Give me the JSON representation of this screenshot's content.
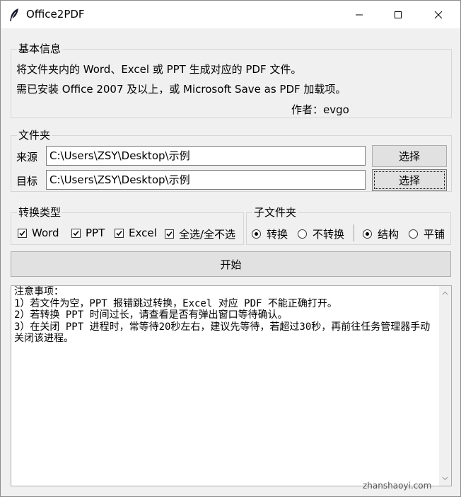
{
  "window": {
    "title": "Office2PDF",
    "icon": "feather-icon",
    "controls": [
      "minimize-icon",
      "maximize-icon",
      "close-icon"
    ]
  },
  "basic_info": {
    "legend": "基本信息",
    "line1": "将文件夹内的 Word、Excel 或 PPT 生成对应的 PDF 文件。",
    "line2": "需已安装 Office 2007 及以上，或 Microsoft Save as PDF 加载项。",
    "author": "作者：evgo"
  },
  "folder": {
    "legend": "文件夹",
    "source_label": "来源",
    "source_value": "C:\\Users\\ZSY\\Desktop\\示例",
    "source_button": "选择",
    "target_label": "目标",
    "target_value": "C:\\Users\\ZSY\\Desktop\\示例",
    "target_button": "选择"
  },
  "convert_type": {
    "legend": "转换类型",
    "options": [
      {
        "label": "Word",
        "checked": true
      },
      {
        "label": "PPT",
        "checked": true
      },
      {
        "label": "Excel",
        "checked": true
      },
      {
        "label": "全选/全不选",
        "checked": true
      }
    ]
  },
  "subfolder": {
    "legend": "子文件夹",
    "convert_options": [
      {
        "label": "转换",
        "selected": true
      },
      {
        "label": "不转换",
        "selected": false
      }
    ],
    "layout_options": [
      {
        "label": "结构",
        "selected": true
      },
      {
        "label": "平铺",
        "selected": false
      }
    ]
  },
  "start_button": "开始",
  "notes": {
    "text": "注意事项：\n1）若文件为空，PPT 报错跳过转换，Excel 对应 PDF 不能正确打开。\n2）若转换 PPT 时间过长，请查看是否有弹出窗口等待确认。\n3）在关闭 PPT 进程时，常等待20秒左右，建议先等待，若超过30秒，再前往任务管理器手动关闭该进程。"
  },
  "watermark": "zhanshaoyi.com"
}
